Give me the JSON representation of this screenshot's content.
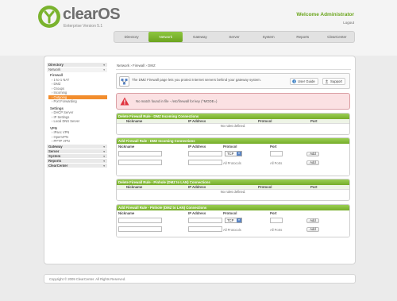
{
  "brand": {
    "name": "clearOS",
    "edition": "Enterprise Version 5.1"
  },
  "header": {
    "welcome": "Welcome Administrator",
    "logout": "Logout"
  },
  "topnav": [
    "Directory",
    "Network",
    "Gateway",
    "Server",
    "System",
    "Reports",
    "ClearCenter"
  ],
  "sidebar": {
    "cat_directory": "Directory",
    "sub_network": "Network",
    "firewall": {
      "title": "Firewall",
      "items": [
        "1-to-1 NAT",
        "DMZ",
        "Groups",
        "Incoming",
        "Outgoing",
        "Port Forwarding"
      ]
    },
    "settings": {
      "title": "Settings",
      "items": [
        "DHCP Server",
        "IP Settings",
        "Local DNS Server"
      ]
    },
    "vpn": {
      "title": "VPN",
      "items": [
        "IPsec VPN",
        "OpenVPN",
        "PPTP VPN"
      ]
    },
    "cats": [
      "Gateway",
      "Server",
      "System",
      "Reports",
      "ClearCenter"
    ]
  },
  "breadcrumb": {
    "part1": "Network",
    "sep": "›",
    "part2": "Firewall",
    "part3": "DMZ"
  },
  "info": {
    "text": "The DMZ Firewall page lets you protect Internet servers behind your gateway system.",
    "user_guide": "User Guide",
    "support": "Support"
  },
  "warning": {
    "text": "No match found in file - /etc/firewall for key (^MODE=)"
  },
  "columns": {
    "nickname": "Nickname",
    "ip": "IP Address",
    "protocol": "Protocol",
    "port": "Port"
  },
  "panels": {
    "delete_incoming": {
      "title": "Delete Firewall Rule - DMZ Incoming Connections",
      "empty": "No rules defined."
    },
    "add_incoming": {
      "title": "Add Firewall Rule - DMZ Incoming Connections",
      "protocol": "TCP",
      "all_protocols": "All Protocols",
      "all_ports": "All Ports",
      "add": "Add"
    },
    "delete_pinhole": {
      "title": "Delete Firewall Rule - Pinhole (DMZ to LAN) Connections",
      "empty": "No rules defined."
    },
    "add_pinhole": {
      "title": "Add Firewall Rule - Pinhole (DMZ to LAN) Connections",
      "protocol": "TCP",
      "all_protocols": "All Protocols",
      "all_ports": "All Ports",
      "add": "Add"
    }
  },
  "footer": {
    "copyright": "Copyright © 2009 ClearCenter. All Rights Reserved."
  },
  "colors": {
    "accent": "#7ab32e",
    "active_item": "#f28d2d",
    "warning_bg": "#fbe1e3"
  }
}
